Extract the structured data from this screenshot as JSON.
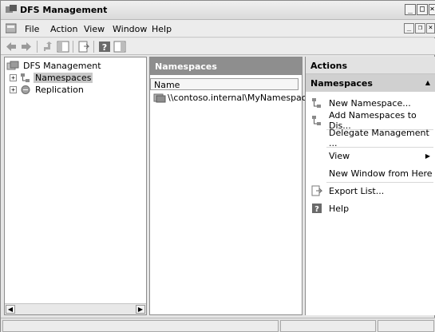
{
  "window": {
    "title": "DFS Management",
    "controls": {
      "minimize": "_",
      "maximize": "□",
      "close": "×"
    }
  },
  "menubar": {
    "items": [
      "File",
      "Action",
      "View",
      "Window",
      "Help"
    ],
    "mdi_controls": {
      "minimize": "_",
      "restore": "❐",
      "close": "×"
    }
  },
  "toolbar": {
    "buttons": [
      "back",
      "forward",
      "up-one-level",
      "show-hide-console-tree",
      "export-list",
      "help",
      "show-hide-action-pane"
    ]
  },
  "tree": {
    "root": "DFS Management",
    "items": [
      {
        "label": "Namespaces",
        "expander": "+",
        "selected": true
      },
      {
        "label": "Replication",
        "expander": "+",
        "selected": false
      }
    ],
    "scroll_left": "◀",
    "scroll_right": "▶"
  },
  "center": {
    "header": "Namespaces",
    "column_header": "Name",
    "rows": [
      {
        "name": "\\\\contoso.internal\\MyNamespace"
      }
    ]
  },
  "actions": {
    "title": "Actions",
    "section": "Namespaces",
    "section_caret": "▲",
    "items": [
      {
        "label": "New Namespace...",
        "icon": "new-namespace-icon"
      },
      {
        "label": "Add Namespaces to Dis...",
        "icon": "add-namespace-icon"
      },
      {
        "label": "Delegate Management ...",
        "icon": ""
      },
      {
        "label": "View",
        "icon": "",
        "submenu": "▶"
      },
      {
        "label": "New Window from Here",
        "icon": ""
      },
      {
        "label": "Export List...",
        "icon": "export-list-icon"
      },
      {
        "label": "Help",
        "icon": "help-icon"
      }
    ]
  },
  "colors": {
    "center_header_bg": "#8e8e8e",
    "actions_section_bg": "#d0d0d0",
    "selected_bg": "#c8c8c8"
  }
}
